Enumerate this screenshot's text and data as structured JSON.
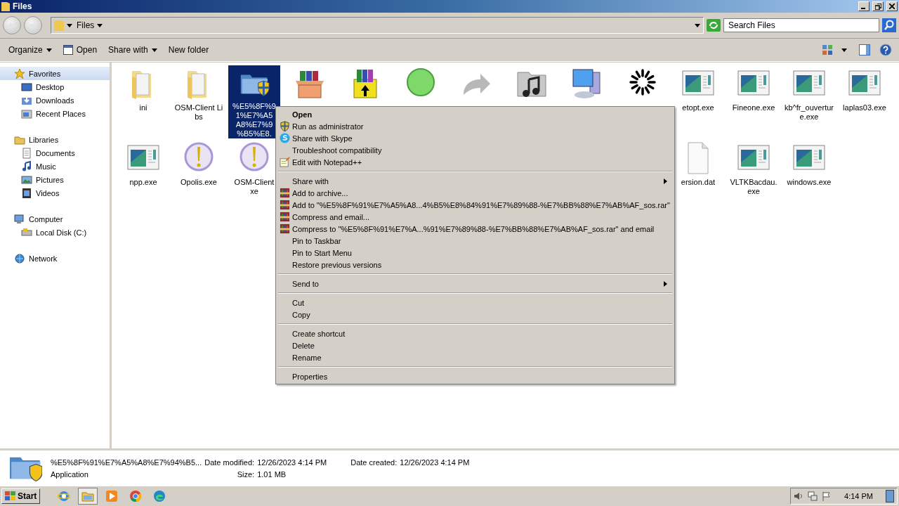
{
  "window": {
    "title": "Files"
  },
  "address": {
    "crumbs": [
      "Files"
    ],
    "search_placeholder": "Search Files"
  },
  "toolbar": {
    "buttons": [
      {
        "label": "Organize",
        "kind": "dropdown"
      },
      {
        "label": "Open",
        "kind": "open"
      },
      {
        "label": "Share with",
        "kind": "dropdown"
      },
      {
        "label": "New folder",
        "kind": "plain"
      }
    ]
  },
  "sidebar": [
    {
      "label": "Favorites",
      "kind": "star",
      "selected": true,
      "children": [
        {
          "label": "Desktop",
          "kind": "desktop",
          "selected": false
        },
        {
          "label": "Downloads",
          "kind": "downloads",
          "selected": false
        },
        {
          "label": "Recent Places",
          "kind": "recent",
          "selected": false
        }
      ]
    },
    {
      "label": "Libraries",
      "kind": "library",
      "selected": false,
      "children": [
        {
          "label": "Documents",
          "kind": "documents",
          "selected": false
        },
        {
          "label": "Music",
          "kind": "music",
          "selected": false
        },
        {
          "label": "Pictures",
          "kind": "pictures",
          "selected": false
        },
        {
          "label": "Videos",
          "kind": "videos",
          "selected": false
        }
      ]
    },
    {
      "label": "Computer",
      "kind": "computer",
      "selected": false,
      "children": [
        {
          "label": "Local Disk (C:)",
          "kind": "disk",
          "selected": false
        }
      ]
    },
    {
      "label": "Network",
      "kind": "network",
      "selected": false
    }
  ],
  "files_row_1": [
    {
      "label": "ini",
      "kind": "folder",
      "selected": false
    },
    {
      "label": "OSM-Client Libs",
      "kind": "folder",
      "selected": false
    },
    {
      "label": "%E5%8F%9\n1%E7%A5\nA8%E7%9\n%B5%E8.",
      "kind": "shield-folder",
      "selected": true
    },
    {
      "kind": "box",
      "selected": false
    },
    {
      "kind": "books",
      "selected": false
    },
    {
      "kind": "ball",
      "selected": false
    },
    {
      "kind": "arrow",
      "selected": false
    },
    {
      "kind": "music",
      "selected": false
    },
    {
      "kind": "computer",
      "selected": false
    },
    {
      "kind": "spinner",
      "selected": false
    },
    {
      "label": "etopt.exe",
      "kind": "window",
      "selected": false
    },
    {
      "label": "Fineone.exe",
      "kind": "window",
      "selected": false
    },
    {
      "label": "kb^fr_ouverture.exe",
      "kind": "window",
      "selected": false
    },
    {
      "label": "laplas03.exe",
      "kind": "window",
      "selected": false
    }
  ],
  "files_row_2_left": [
    {
      "label": "npp.exe",
      "kind": "window",
      "selected": false
    },
    {
      "label": "Opolis.exe",
      "kind": "exclamation",
      "selected": false
    },
    {
      "label": "OSM-Client\nxe",
      "kind": "exclamation",
      "selected": false
    }
  ],
  "files_row_2_right": [
    {
      "label": "ersion.dat",
      "kind": "document",
      "selected": false
    },
    {
      "label": "VLTKBacdau.exe",
      "kind": "window",
      "selected": false
    },
    {
      "label": "windows.exe",
      "kind": "window",
      "selected": false
    }
  ],
  "context_menu": {
    "groups": [
      [
        {
          "label": "Open",
          "kind": "plain",
          "default": true,
          "submenu": false
        },
        {
          "label": "Run as administrator",
          "kind": "shield",
          "default": false,
          "submenu": false
        },
        {
          "label": "Share with Skype",
          "kind": "skype",
          "default": false,
          "submenu": false
        },
        {
          "label": "Troubleshoot compatibility",
          "kind": "plain",
          "default": false,
          "submenu": false
        },
        {
          "label": "Edit with Notepad++",
          "kind": "notepad",
          "default": false,
          "submenu": false
        }
      ],
      [
        {
          "label": "Share with",
          "kind": "plain",
          "default": false,
          "submenu": true
        },
        {
          "label": "Add to archive...",
          "kind": "archive",
          "default": false,
          "submenu": false
        },
        {
          "label": "Add to \"%E5%8F%91%E7%A5%A8...4%B5%E8%84%91%E7%89%88-%E7%BB%88%E7%AB%AF_sos.rar\"",
          "kind": "archive",
          "default": false,
          "submenu": false
        },
        {
          "label": "Compress and email...",
          "kind": "archive",
          "default": false,
          "submenu": false
        },
        {
          "label": "Compress to \"%E5%8F%91%E7%A...%91%E7%89%88-%E7%BB%88%E7%AB%AF_sos.rar\" and email",
          "kind": "archive",
          "default": false,
          "submenu": false
        },
        {
          "label": "Pin to Taskbar",
          "kind": "plain",
          "default": false,
          "submenu": false
        },
        {
          "label": "Pin to Start Menu",
          "kind": "plain",
          "default": false,
          "submenu": false
        },
        {
          "label": "Restore previous versions",
          "kind": "plain",
          "default": false,
          "submenu": false
        }
      ],
      [
        {
          "label": "Send to",
          "kind": "plain",
          "default": false,
          "submenu": true
        }
      ],
      [
        {
          "label": "Cut",
          "kind": "plain",
          "default": false,
          "submenu": false
        },
        {
          "label": "Copy",
          "kind": "plain",
          "default": false,
          "submenu": false
        }
      ],
      [
        {
          "label": "Create shortcut",
          "kind": "plain",
          "default": false,
          "submenu": false
        },
        {
          "label": "Delete",
          "kind": "plain",
          "default": false,
          "submenu": false
        },
        {
          "label": "Rename",
          "kind": "plain",
          "default": false,
          "submenu": false
        }
      ],
      [
        {
          "label": "Properties",
          "kind": "plain",
          "default": false,
          "submenu": false
        }
      ]
    ]
  },
  "details": {
    "name": "%E5%8F%91%E7%A5%A8%E7%94%B5...",
    "type": "Application",
    "fields": [
      {
        "label": "Date modified:",
        "value": "12/26/2023 4:14 PM"
      },
      {
        "label": "Date created:",
        "value": "12/26/2023 4:14 PM"
      },
      {
        "label": "Size:",
        "value": "1.01 MB"
      }
    ]
  },
  "taskbar": {
    "start": "Start",
    "apps": [
      {
        "kind": "ie",
        "selected": false
      },
      {
        "kind": "explorer",
        "selected": true
      },
      {
        "kind": "media",
        "selected": false
      },
      {
        "kind": "chrome",
        "selected": false
      },
      {
        "kind": "edge",
        "selected": false
      }
    ],
    "clock": "4:14 PM"
  }
}
